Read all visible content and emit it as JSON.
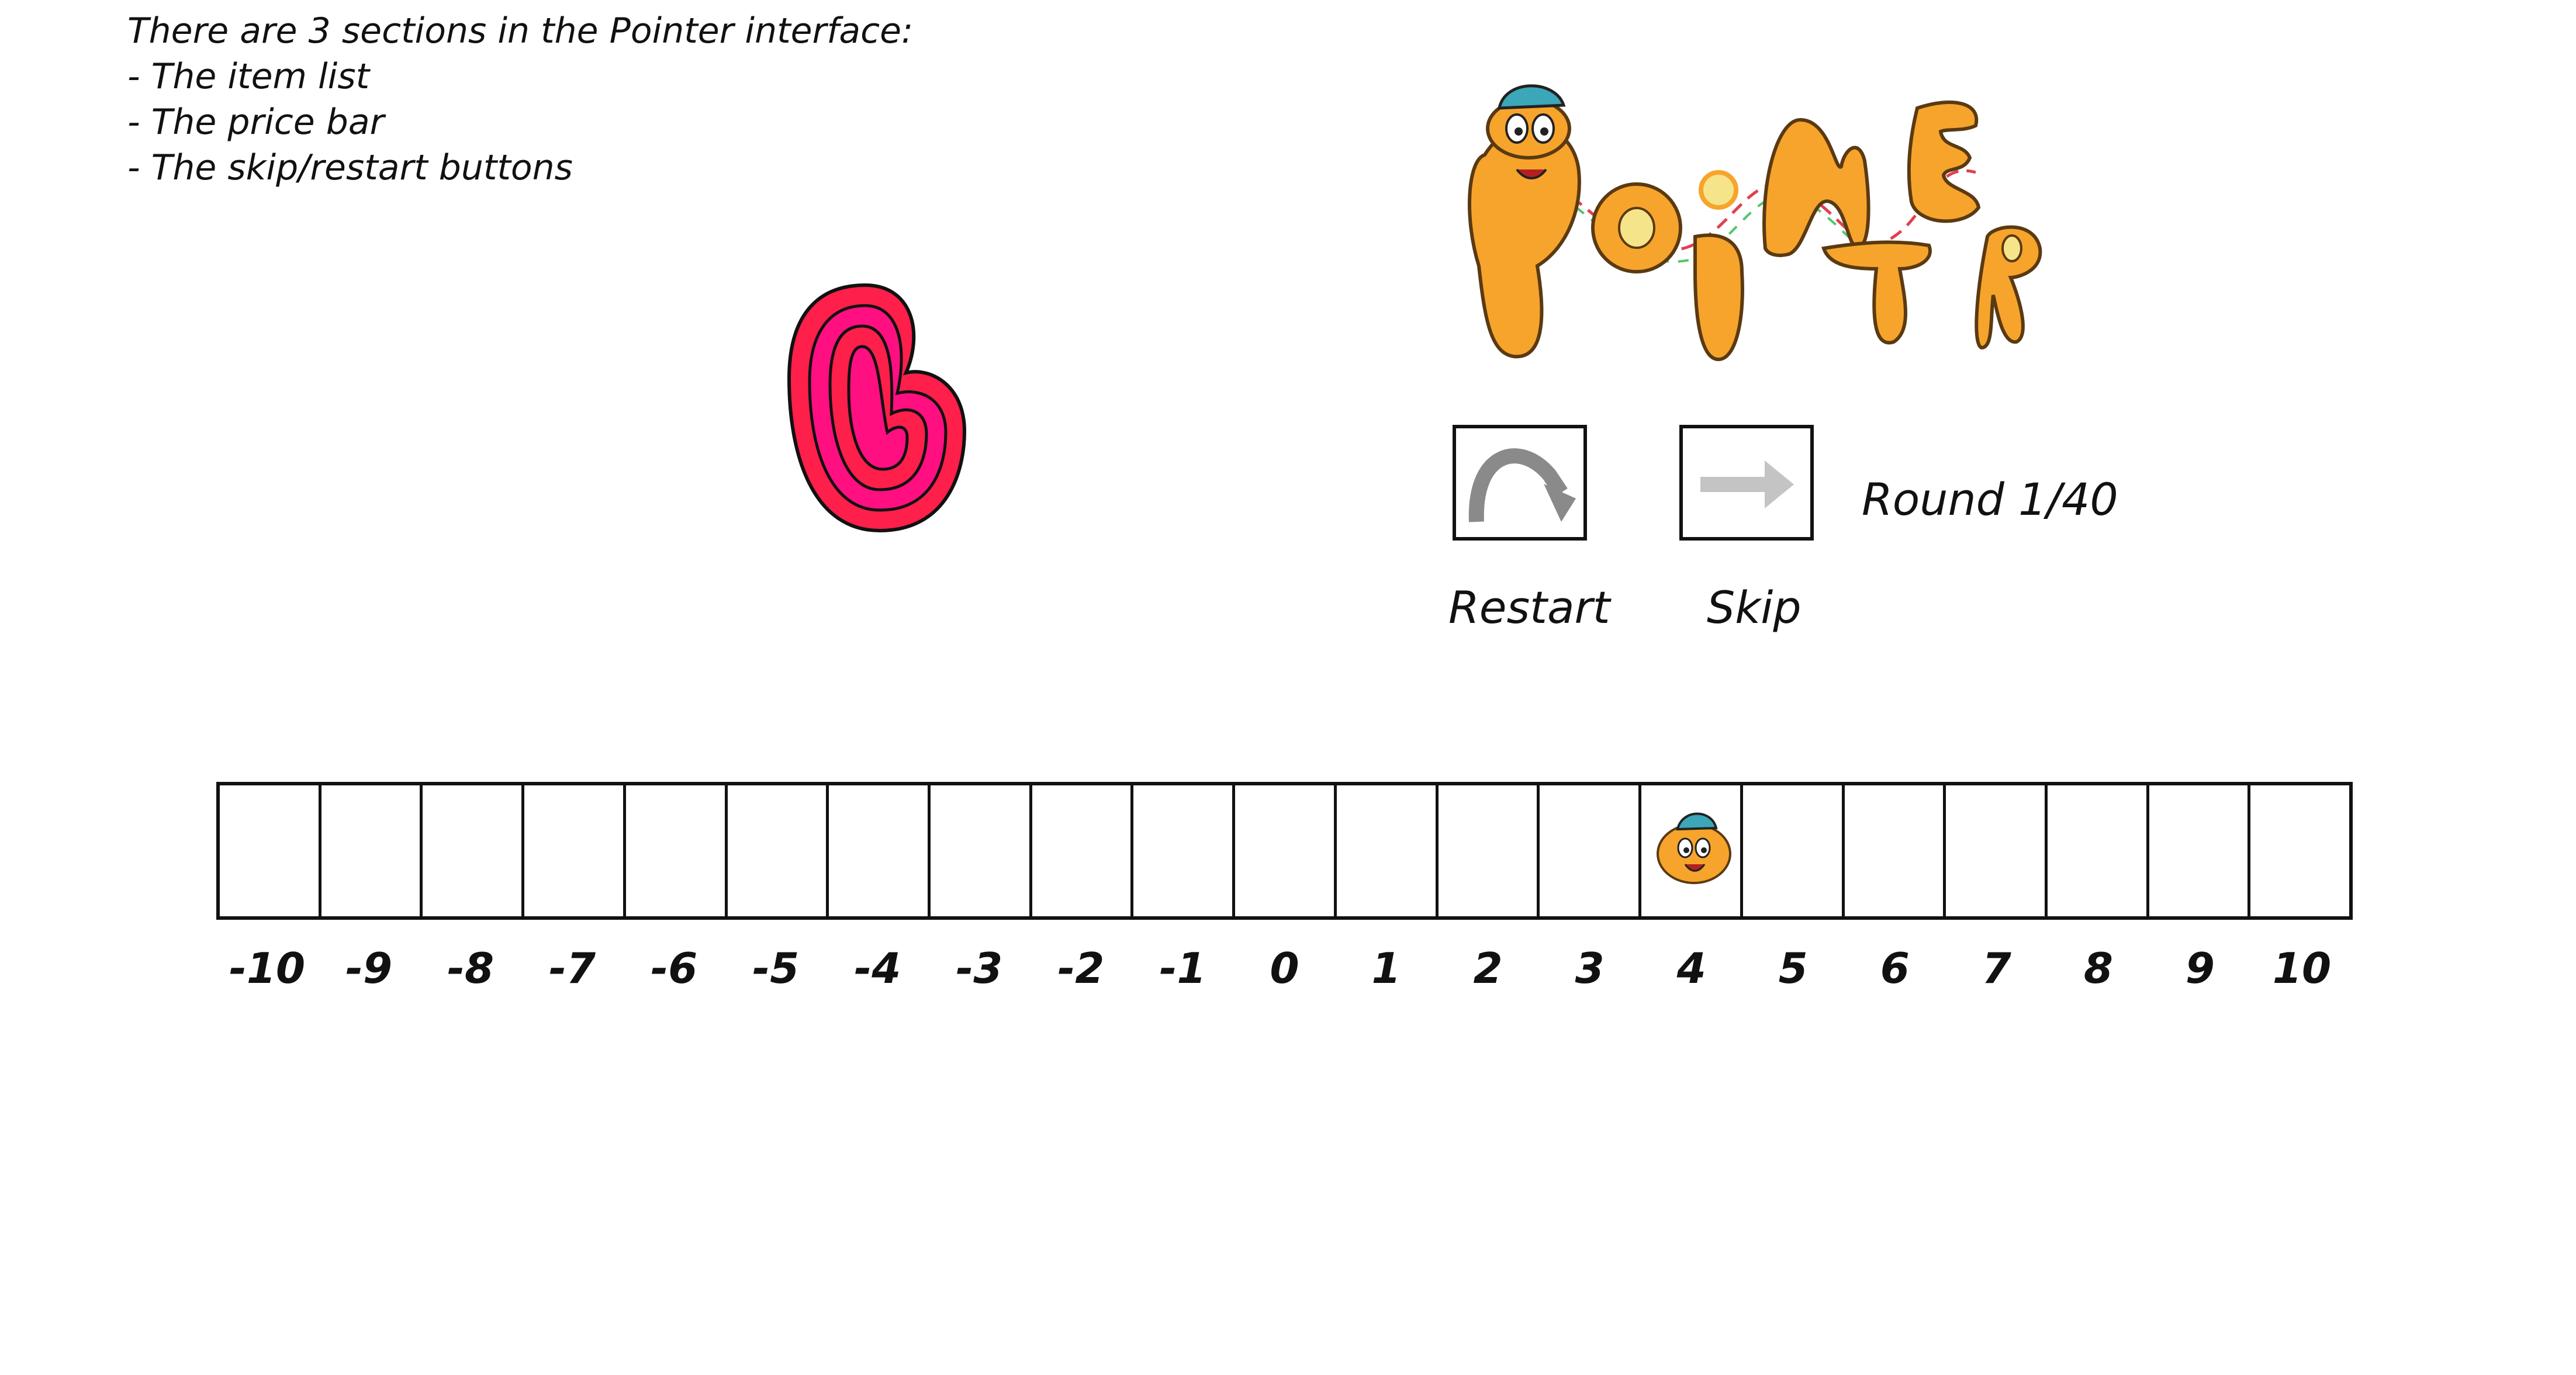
{
  "instructions": {
    "heading": "There are 3 sections in the Pointer interface:",
    "items": [
      "- The item list",
      "- The price bar",
      "- The skip/restart buttons"
    ]
  },
  "item_list": {
    "current_item": "pink-swirl-item"
  },
  "logo": {
    "text": "Pointer",
    "colors": {
      "fill": "#f7a42c",
      "outline": "#5a3a12",
      "cap": "#3ba7b8"
    }
  },
  "controls": {
    "restart_label": "Restart",
    "skip_label": "Skip",
    "round_text": "Round 1/40"
  },
  "price_bar": {
    "ticks": [
      "-10",
      "-9",
      "-8",
      "-7",
      "-6",
      "-5",
      "-4",
      "-3",
      "-2",
      "-1",
      "0",
      "1",
      "2",
      "3",
      "4",
      "5",
      "6",
      "7",
      "8",
      "9",
      "10"
    ],
    "pointer_value": 4
  },
  "colors": {
    "item_outer": "#ff1f4b",
    "item_inner": "#ff0f80",
    "pointer": "#f7a42c",
    "cap": "#3ba7b8"
  }
}
